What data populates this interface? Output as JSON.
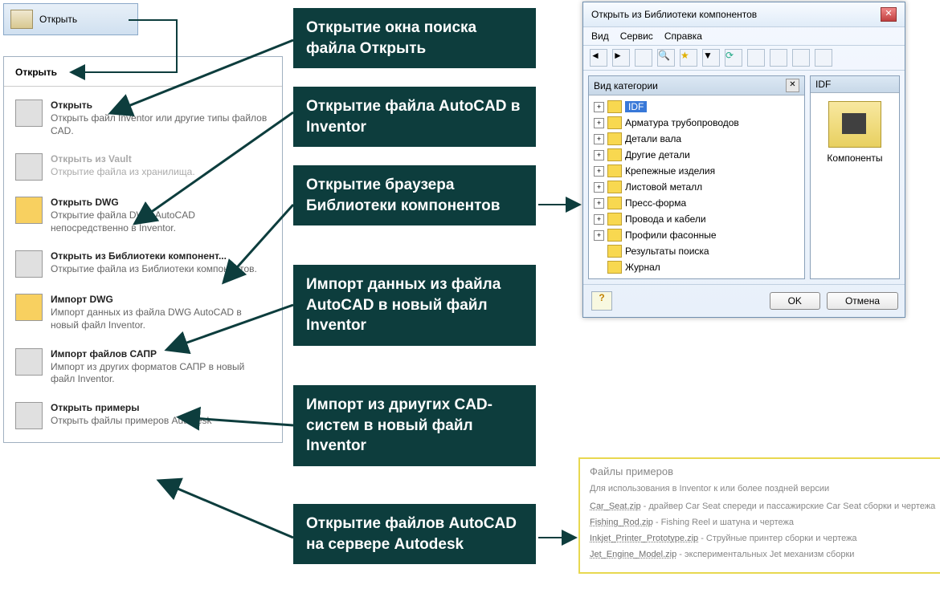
{
  "ribbon": {
    "open_label": "Открыть"
  },
  "menu": {
    "header": "Открыть",
    "items": [
      {
        "title": "Открыть",
        "desc": "Открыть файл Inventor или другие типы файлов CAD."
      },
      {
        "title": "Открыть из Vault",
        "desc": "Открытие файла из хранилища."
      },
      {
        "title": "Открыть DWG",
        "desc": "Открытие файла DWG AutoCAD непосредственно в Inventor."
      },
      {
        "title": "Открыть из Библиотеки компонент...",
        "desc": "Открытие файла из Библиотеки компонентов."
      },
      {
        "title": "Импорт DWG",
        "desc": "Импорт данных из файла DWG AutoCAD в новый файл Inventor."
      },
      {
        "title": "Импорт файлов САПР",
        "desc": "Импорт из других форматов САПР в новый файл Inventor."
      },
      {
        "title": "Открыть примеры",
        "desc": "Открыть файлы примеров Autodesk"
      }
    ]
  },
  "callouts": {
    "c1": "Открытие окна поиска файла Открыть",
    "c2": "Открытие файла AutoCAD в Inventor",
    "c3": "Открытие браузера Библиотеки компонентов",
    "c4": "Импорт данных из файла  AutoCAD  в новый файл Inventor",
    "c5": "Импорт из дриугих CAD-систем  в новый файл Inventor",
    "c6": "Открытие файлов  AutoCAD  на сервере Autodesk"
  },
  "library": {
    "title": "Открыть из Библиотеки компонентов",
    "menus": {
      "view": "Вид",
      "service": "Сервис",
      "help": "Справка"
    },
    "tree_header": "Вид категории",
    "right_header": "IDF",
    "right_item": "Компоненты",
    "tree": [
      {
        "label": "IDF",
        "selected": true
      },
      {
        "label": "Арматура трубопроводов"
      },
      {
        "label": "Детали вала"
      },
      {
        "label": "Другие детали"
      },
      {
        "label": "Крепежные изделия"
      },
      {
        "label": "Листовой металл"
      },
      {
        "label": "Пресс-форма"
      },
      {
        "label": "Провода и кабели"
      },
      {
        "label": "Профили фасонные"
      },
      {
        "label": "Результаты поиска",
        "noplus": true
      },
      {
        "label": "Журнал",
        "noplus": true
      }
    ],
    "ok": "OK",
    "cancel": "Отмена",
    "help_q": "?"
  },
  "samples": {
    "title": "Файлы примеров",
    "sub": "Для использования в Inventor к или более поздней версии",
    "rows": [
      {
        "fn": "Car_Seat.zip",
        "desc": " - драйвер Car Seat спереди и пассажирские Car Seat сборки и чертежа"
      },
      {
        "fn": "Fishing_Rod.zip",
        "desc": " - Fishing Reel и шатуна и чертежа"
      },
      {
        "fn": "Inkjet_Printer_Prototype.zip",
        "desc": " - Струйные принтер сборки и чертежа"
      },
      {
        "fn": "Jet_Engine_Model.zip",
        "desc": " - экспериментальных Jet механизм сборки"
      }
    ]
  }
}
